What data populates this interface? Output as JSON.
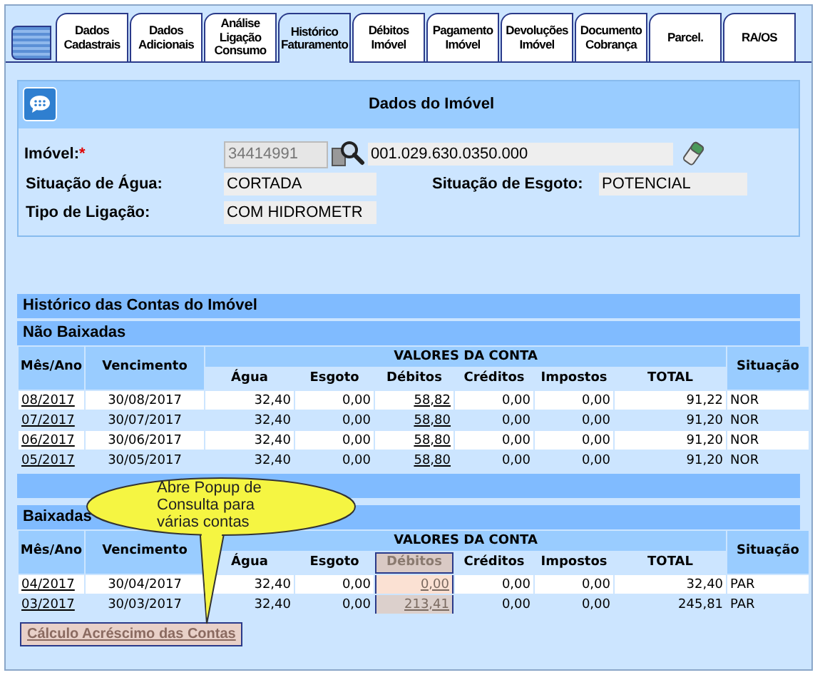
{
  "tabs": [
    {
      "label": "Dados\nCadastrais",
      "selected": false
    },
    {
      "label": "Dados\nAdicionais",
      "selected": false
    },
    {
      "label": "Análise\nLigação\nConsumo",
      "selected": false
    },
    {
      "label": "Histórico\nFaturamento",
      "selected": true
    },
    {
      "label": "Débitos\nImóvel",
      "selected": false
    },
    {
      "label": "Pagamento\nImóvel",
      "selected": false
    },
    {
      "label": "Devoluções\nImóvel",
      "selected": false
    },
    {
      "label": "Documento\nCobrança",
      "selected": false
    },
    {
      "label": "Parcel.",
      "selected": false
    },
    {
      "label": "RA/OS",
      "selected": false
    }
  ],
  "imovel_panel": {
    "title": "Dados do Imóvel",
    "imovel_label": "Imóvel:",
    "required_mark": "*",
    "matricula": "34414991",
    "inscricao": "001.029.630.0350.000",
    "fields": [
      {
        "label": "Situação de Água:",
        "value": "CORTADA"
      },
      {
        "label": "Situação de Esgoto:",
        "value": "POTENCIAL"
      },
      {
        "label": "Tipo de Ligação:",
        "value": "COM HIDROMETR"
      }
    ]
  },
  "historico": {
    "title": "Histórico das Contas do Imóvel",
    "groups": [
      {
        "title": "Não Baixadas",
        "group_header": "VALORES DA CONTA",
        "columns": [
          {
            "label": "Mês/Ano",
            "highlighted": false
          },
          {
            "label": "Vencimento",
            "highlighted": false
          },
          {
            "label": "Água",
            "highlighted": false
          },
          {
            "label": "Esgoto",
            "highlighted": false
          },
          {
            "label": "Débitos",
            "highlighted": false
          },
          {
            "label": "Créditos",
            "highlighted": false
          },
          {
            "label": "Impostos",
            "highlighted": false
          },
          {
            "label": "TOTAL",
            "highlighted": false
          },
          {
            "label": "Situação",
            "highlighted": false
          }
        ],
        "rows": [
          [
            "08/2017",
            "30/08/2017",
            "32,40",
            "0,00",
            "58,82",
            "0,00",
            "0,00",
            "91,22",
            "NOR"
          ],
          [
            "07/2017",
            "30/07/2017",
            "32,40",
            "0,00",
            "58,80",
            "0,00",
            "0,00",
            "91,20",
            "NOR"
          ],
          [
            "06/2017",
            "30/06/2017",
            "32,40",
            "0,00",
            "58,80",
            "0,00",
            "0,00",
            "91,20",
            "NOR"
          ],
          [
            "05/2017",
            "30/05/2017",
            "32,40",
            "0,00",
            "58,80",
            "0,00",
            "0,00",
            "91,20",
            "NOR"
          ]
        ]
      },
      {
        "title": "Baixadas",
        "group_header": "VALORES DA CONTA",
        "columns": [
          {
            "label": "Mês/Ano",
            "highlighted": false
          },
          {
            "label": "Vencimento",
            "highlighted": false
          },
          {
            "label": "Água",
            "highlighted": false
          },
          {
            "label": "Esgoto",
            "highlighted": false
          },
          {
            "label": "Débitos",
            "highlighted": true
          },
          {
            "label": "Créditos",
            "highlighted": false
          },
          {
            "label": "Impostos",
            "highlighted": false
          },
          {
            "label": "TOTAL",
            "highlighted": false
          },
          {
            "label": "Situação",
            "highlighted": false
          }
        ],
        "rows": [
          [
            "04/2017",
            "30/04/2017",
            "32,40",
            "0,00",
            "0,00",
            "0,00",
            "0,00",
            "32,40",
            "PAR"
          ],
          [
            "03/2017",
            "30/03/2017",
            "32,40",
            "0,00",
            "213,41",
            "0,00",
            "0,00",
            "245,81",
            "PAR"
          ]
        ]
      }
    ]
  },
  "calc_button": {
    "label": "Cálculo Acréscimo das Contas",
    "disabled": true
  },
  "callout": {
    "text": "Abre Popup de Consulta para várias contas"
  }
}
